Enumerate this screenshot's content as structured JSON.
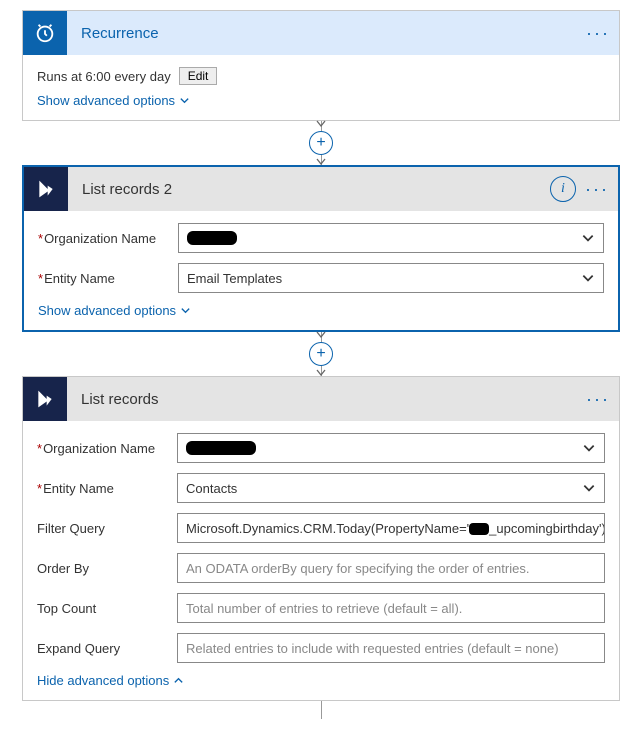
{
  "colors": {
    "accent": "#0b63ad",
    "darkTile": "#17244b"
  },
  "recurrence": {
    "title": "Recurrence",
    "runText": "Runs at 6:00 every day",
    "editLabel": "Edit",
    "advancedLabel": "Show advanced options"
  },
  "listRecords2": {
    "title": "List records 2",
    "orgLabel": "Organization Name",
    "orgValue": "",
    "entityLabel": "Entity Name",
    "entityValue": "Email Templates",
    "advancedLabel": "Show advanced options"
  },
  "listRecords": {
    "title": "List records",
    "orgLabel": "Organization Name",
    "orgValue": "",
    "entityLabel": "Entity Name",
    "entityValue": "Contacts",
    "filterLabel": "Filter Query",
    "filterPrefix": "Microsoft.Dynamics.CRM.Today(PropertyName='",
    "filterSuffix": "_upcomingbirthday')",
    "orderByLabel": "Order By",
    "orderByPlaceholder": "An ODATA orderBy query for specifying the order of entries.",
    "topCountLabel": "Top Count",
    "topCountPlaceholder": "Total number of entries to retrieve (default = all).",
    "expandLabel": "Expand Query",
    "expandPlaceholder": "Related entries to include with requested entries (default = none)",
    "advancedLabel": "Hide advanced options"
  }
}
